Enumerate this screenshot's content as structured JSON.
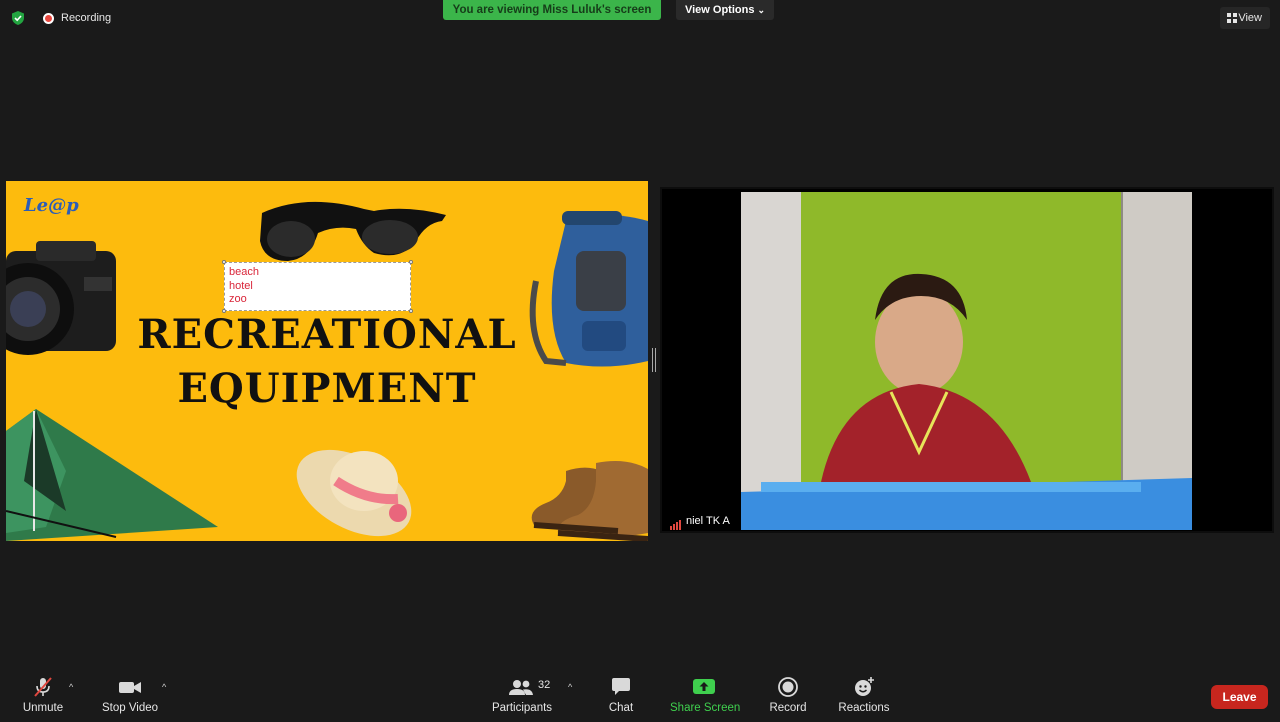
{
  "topbar": {
    "recording_label": "Recording",
    "viewing_banner": "You are viewing Miss Luluk's screen",
    "view_options_label": "View Options",
    "view_label": "View"
  },
  "shared_slide": {
    "title_line1": "RECREATIONAL",
    "title_line2": "EQUIPMENT",
    "logo_text": "Le@p",
    "textbox_lines": [
      "beach",
      "hotel",
      "zoo"
    ],
    "background_color": "#fdbb0d"
  },
  "participant_video": {
    "name": "niel TK A"
  },
  "toolbar": {
    "unmute_label": "Unmute",
    "stop_video_label": "Stop Video",
    "participants_label": "Participants",
    "participants_count": "32",
    "chat_label": "Chat",
    "share_screen_label": "Share Screen",
    "record_label": "Record",
    "reactions_label": "Reactions",
    "leave_label": "Leave"
  },
  "colors": {
    "share_green": "#3fcf4e",
    "banner_green": "#3bb54a",
    "leave_red": "#c7261e",
    "recording_red": "#e9473f"
  }
}
